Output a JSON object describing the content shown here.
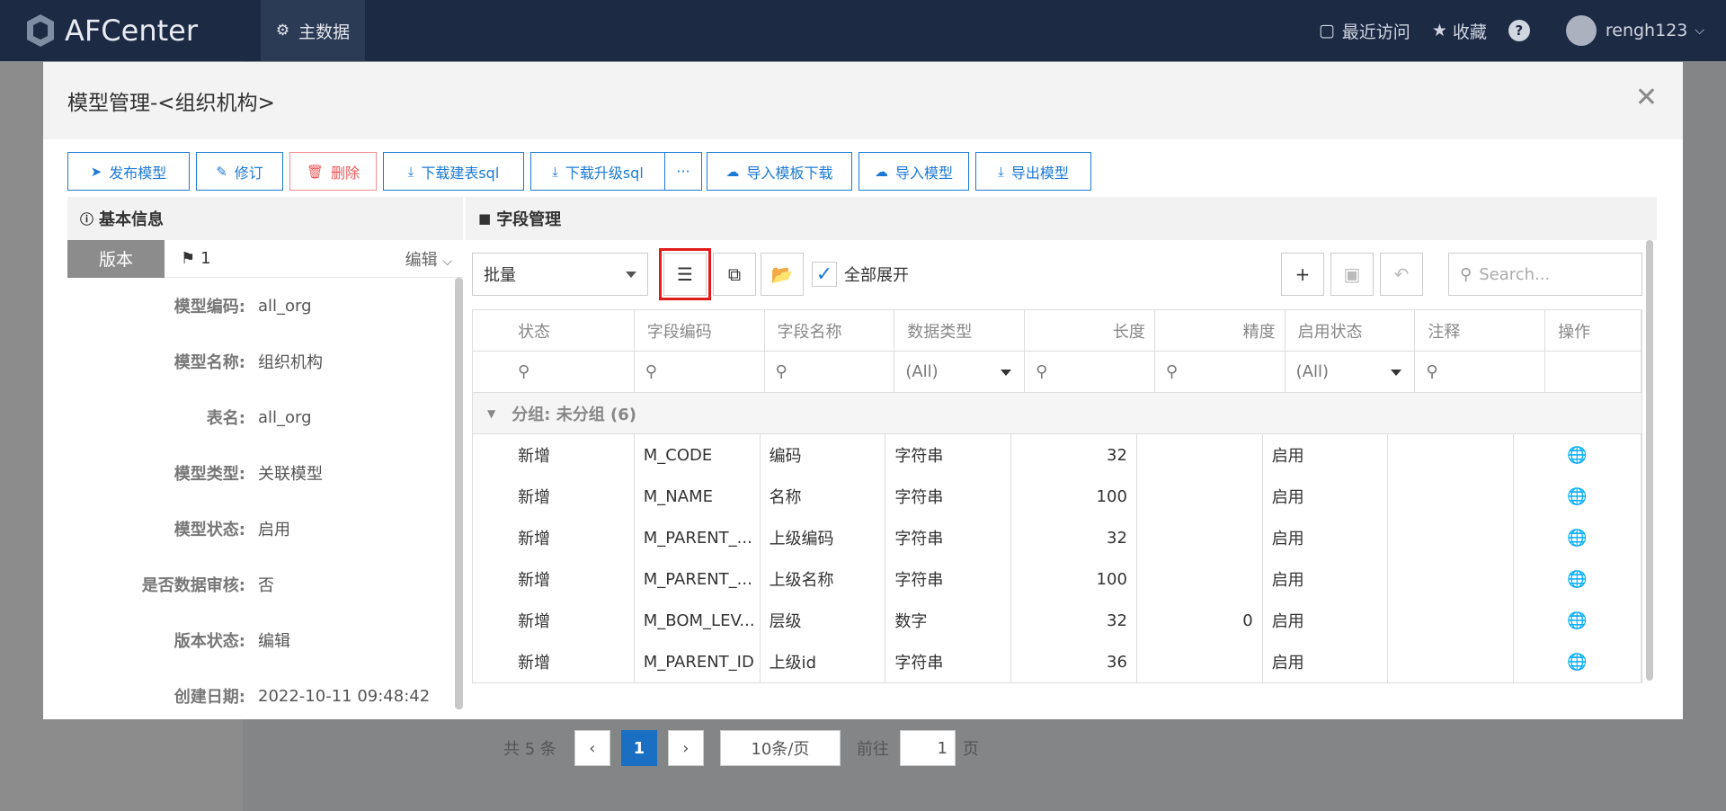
{
  "app": {
    "name": "AFCenter",
    "menu_label": "主数据",
    "recent_label": "最近访问",
    "favorites_label": "收藏",
    "help_label": "?",
    "username": "rengh123"
  },
  "pager": {
    "total": "共 5 条",
    "current_page": "1",
    "page_size": "10条/页",
    "goto_label": "前往",
    "goto_value": "1",
    "page_unit": "页"
  },
  "modal": {
    "title": "模型管理-<组织机构>",
    "toolbar": [
      "发布模型",
      "修订",
      "删除",
      "下载建表sql",
      "下载升级sql",
      "···",
      "导入模板下载",
      "导入模型",
      "导出模型"
    ],
    "basic": {
      "header": "基本信息",
      "version_tag": "版本",
      "version_num": "1",
      "version_edit": "编辑",
      "rows": [
        {
          "label": "模型编码:",
          "value": "all_org"
        },
        {
          "label": "模型名称:",
          "value": "组织机构"
        },
        {
          "label": "表名:",
          "value": "all_org"
        },
        {
          "label": "模型类型:",
          "value": "关联模型"
        },
        {
          "label": "模型状态:",
          "value": "启用"
        },
        {
          "label": "是否数据审核:",
          "value": "否"
        },
        {
          "label": "版本状态:",
          "value": "编辑"
        },
        {
          "label": "创建日期:",
          "value": "2022-10-11 09:48:42"
        }
      ]
    },
    "fields": {
      "header": "字段管理",
      "batch_label": "批量",
      "expand_label": "全部展开",
      "search_placeholder": "Search...",
      "columns": [
        "状态",
        "字段编码",
        "字段名称",
        "数据类型",
        "长度",
        "精度",
        "启用状态",
        "注释",
        "操作"
      ],
      "filter_all": "(All)",
      "group_label": "分组: 未分组 (6)",
      "rows": [
        {
          "status": "新增",
          "code": "M_CODE",
          "name": "编码",
          "type": "字符串",
          "length": "32",
          "precision": "",
          "enabled": "启用"
        },
        {
          "status": "新增",
          "code": "M_NAME",
          "name": "名称",
          "type": "字符串",
          "length": "100",
          "precision": "",
          "enabled": "启用"
        },
        {
          "status": "新增",
          "code": "M_PARENT_...",
          "name": "上级编码",
          "type": "字符串",
          "length": "32",
          "precision": "",
          "enabled": "启用"
        },
        {
          "status": "新增",
          "code": "M_PARENT_...",
          "name": "上级名称",
          "type": "字符串",
          "length": "100",
          "precision": "",
          "enabled": "启用"
        },
        {
          "status": "新增",
          "code": "M_BOM_LEV...",
          "name": "层级",
          "type": "数字",
          "length": "32",
          "precision": "0",
          "enabled": "启用"
        },
        {
          "status": "新增",
          "code": "M_PARENT_ID",
          "name": "上级id",
          "type": "字符串",
          "length": "36",
          "precision": "",
          "enabled": "启用"
        }
      ]
    }
  }
}
